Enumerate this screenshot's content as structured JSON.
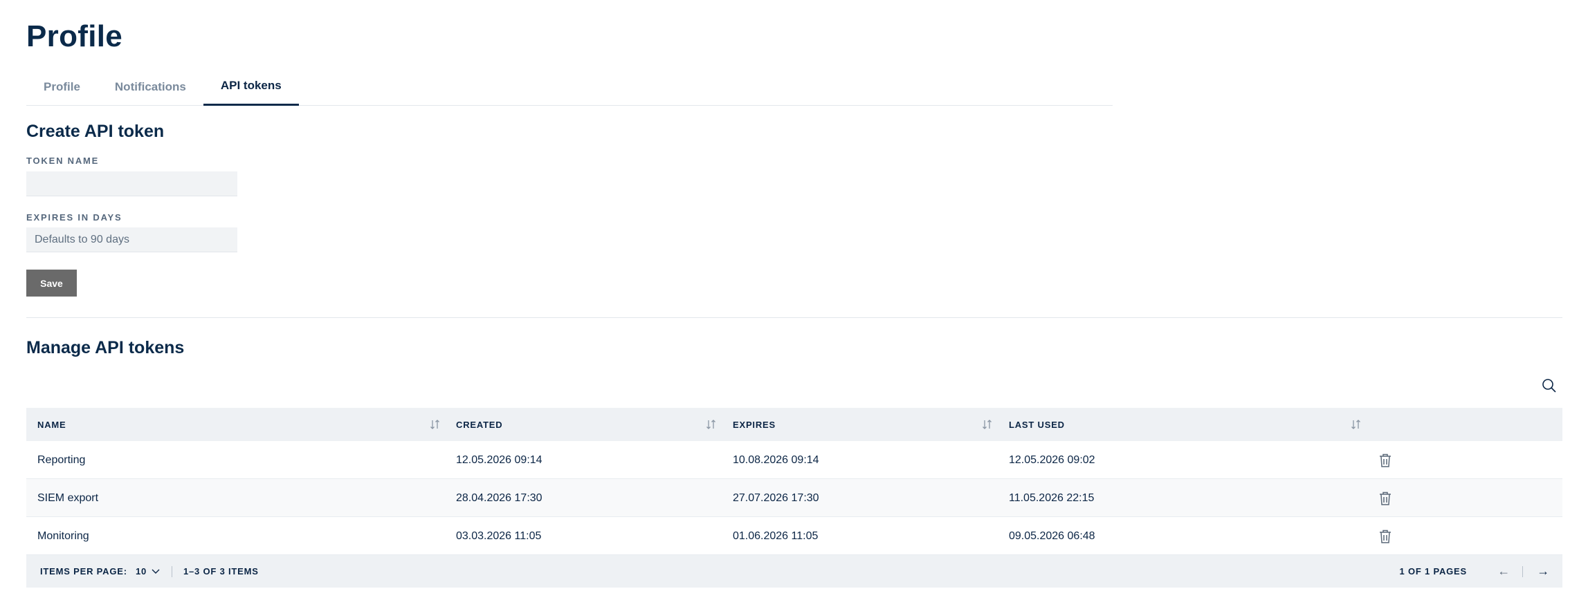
{
  "page": {
    "title": "Profile"
  },
  "tabs": [
    {
      "label": "Profile",
      "active": false
    },
    {
      "label": "Notifications",
      "active": false
    },
    {
      "label": "API tokens",
      "active": true
    }
  ],
  "create": {
    "heading": "Create API token",
    "token_name_label": "TOKEN NAME",
    "token_name_value": "",
    "expires_label": "EXPIRES IN DAYS",
    "expires_placeholder": "Defaults to 90 days",
    "save_label": "Save"
  },
  "manage": {
    "heading": "Manage API tokens",
    "search_icon": "search-icon",
    "columns": [
      "NAME",
      "CREATED",
      "EXPIRES",
      "LAST USED"
    ],
    "rows": [
      {
        "name": "Reporting",
        "created": "12.05.2026 09:14",
        "expires": "10.08.2026 09:14",
        "last_used": "12.05.2026 09:02"
      },
      {
        "name": "SIEM export",
        "created": "28.04.2026 17:30",
        "expires": "27.07.2026 17:30",
        "last_used": "11.05.2026 22:15"
      },
      {
        "name": "Monitoring",
        "created": "03.03.2026 11:05",
        "expires": "01.06.2026 11:05",
        "last_used": "09.05.2026 06:48"
      }
    ],
    "pagination": {
      "items_per_page_label": "ITEMS PER PAGE:",
      "items_per_page": "10",
      "range": "1–3 OF 3 ITEMS",
      "pages": "1 OF 1 PAGES",
      "prev": "←",
      "next": "→"
    }
  },
  "colors": {
    "primary_text": "#0b2545",
    "muted_tab": "#7a8a9c",
    "header_bg": "#eef1f4",
    "save_button_bg": "#6a6a6a"
  }
}
